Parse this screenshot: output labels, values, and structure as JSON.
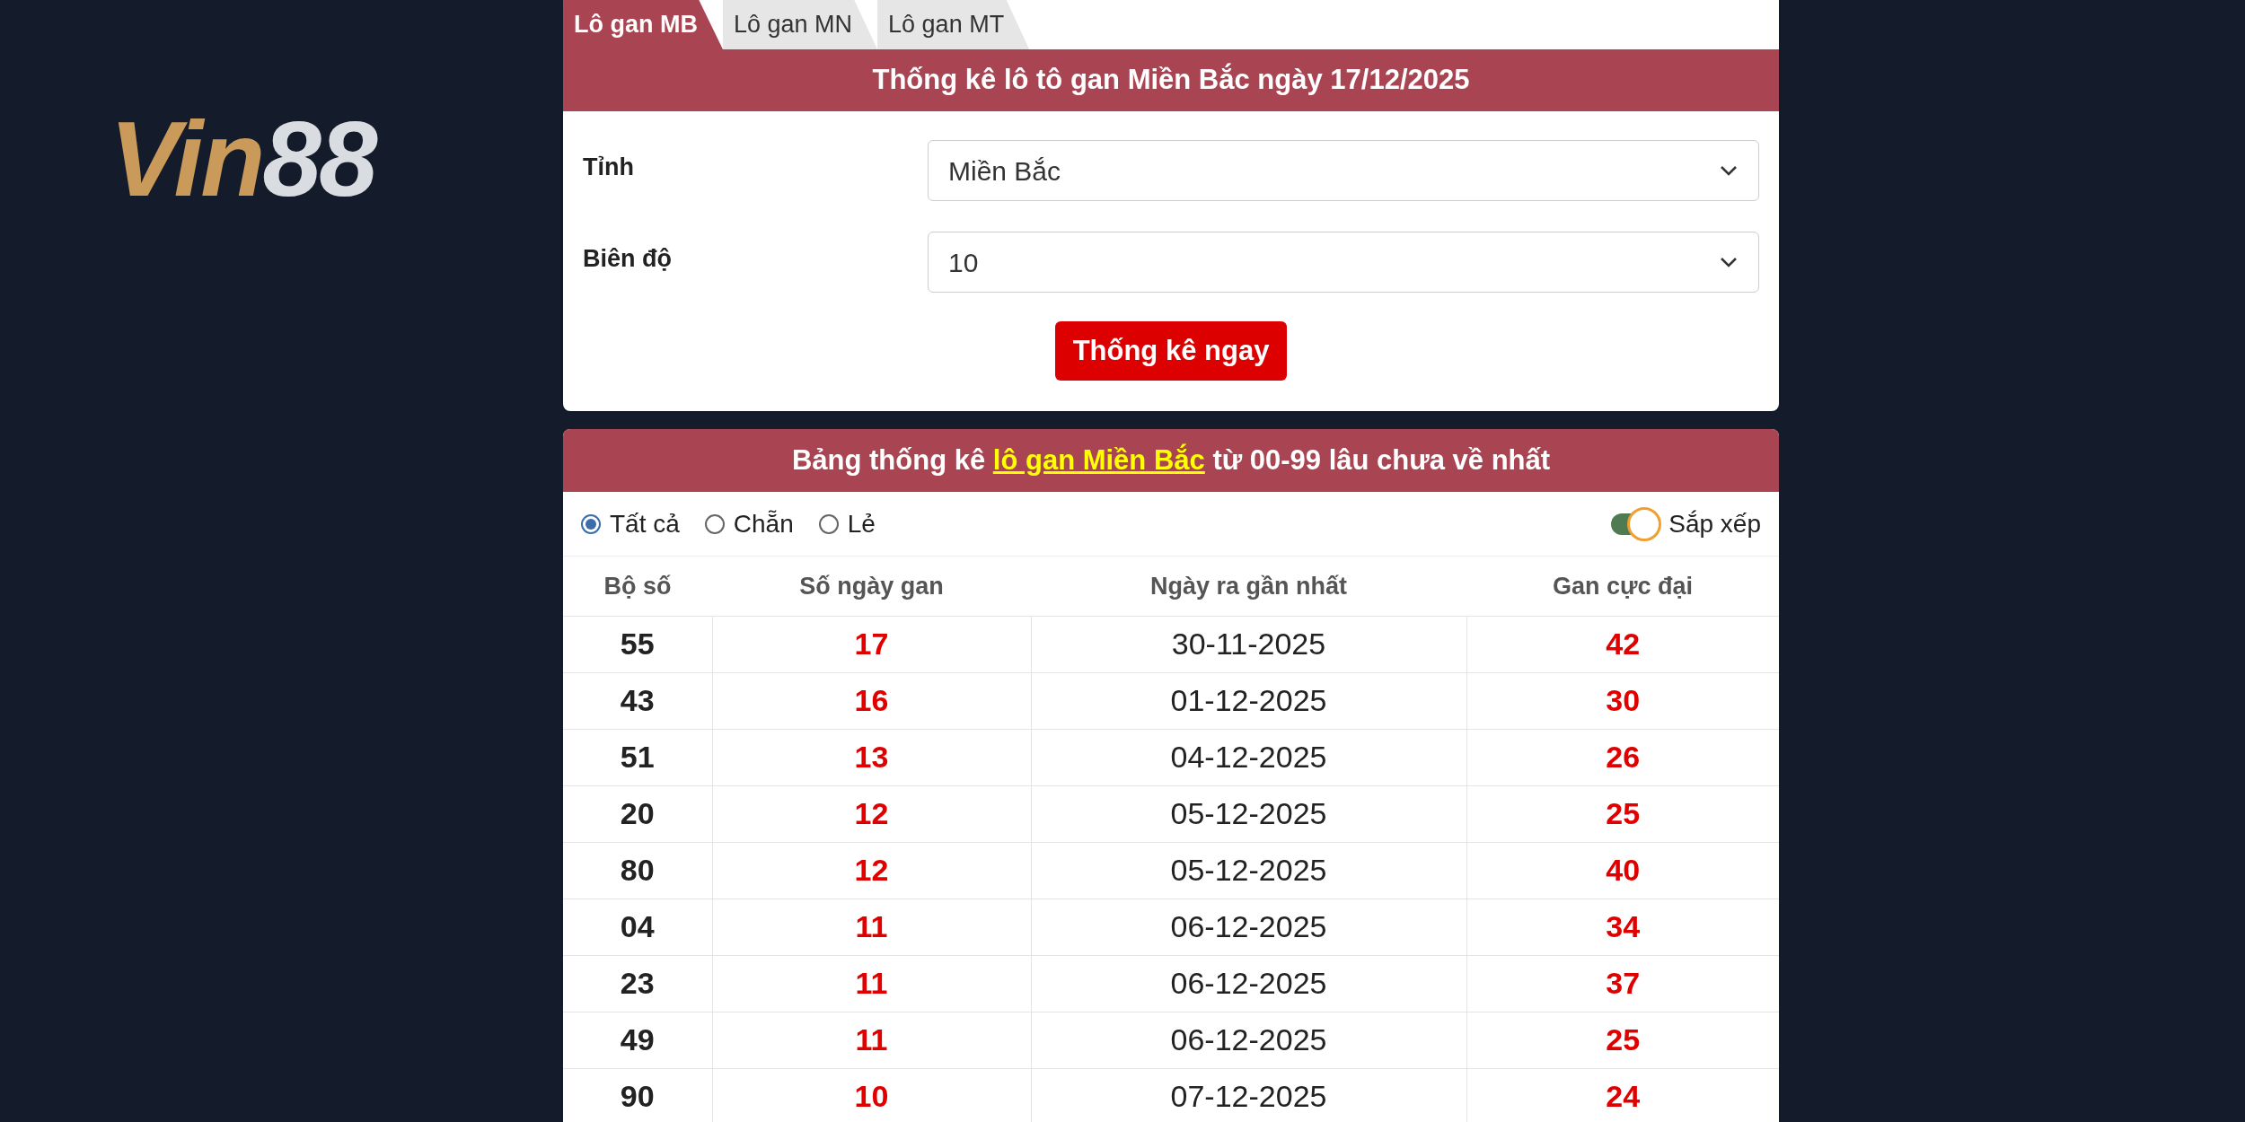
{
  "logo": {
    "word": "Vin",
    "number": "88"
  },
  "tabs": [
    {
      "label": "Lô gan MB",
      "selected": true
    },
    {
      "label": "Lô gan MN",
      "selected": false
    },
    {
      "label": "Lô gan MT",
      "selected": false
    }
  ],
  "form": {
    "title": "Thống kê lô tô gan Miền Bắc ngày 17/12/2025",
    "fields": [
      {
        "label": "Tỉnh",
        "value": "Miền Bắc"
      },
      {
        "label": "Biên độ",
        "value": "10"
      }
    ],
    "button": "Thống kê ngay"
  },
  "table_card": {
    "title_before": "Bảng thống kê ",
    "title_link": "lô gan Miền Bắc",
    "title_after": " từ 00-99 lâu chưa về nhất",
    "filters": [
      {
        "label": "Tất cả",
        "selected": true
      },
      {
        "label": "Chẵn",
        "selected": false
      },
      {
        "label": "Lẻ",
        "selected": false
      }
    ],
    "sort_toggle": {
      "label": "Sắp xếp",
      "on": true
    },
    "columns": [
      "Bộ số",
      "Số ngày gan",
      "Ngày ra gần nhất",
      "Gan cực đại"
    ],
    "rows": [
      [
        "55",
        "17",
        "30-11-2025",
        "42"
      ],
      [
        "43",
        "16",
        "01-12-2025",
        "30"
      ],
      [
        "51",
        "13",
        "04-12-2025",
        "26"
      ],
      [
        "20",
        "12",
        "05-12-2025",
        "25"
      ],
      [
        "80",
        "12",
        "05-12-2025",
        "40"
      ],
      [
        "04",
        "11",
        "06-12-2025",
        "34"
      ],
      [
        "23",
        "11",
        "06-12-2025",
        "37"
      ],
      [
        "49",
        "11",
        "06-12-2025",
        "25"
      ],
      [
        "90",
        "10",
        "07-12-2025",
        "24"
      ]
    ]
  }
}
